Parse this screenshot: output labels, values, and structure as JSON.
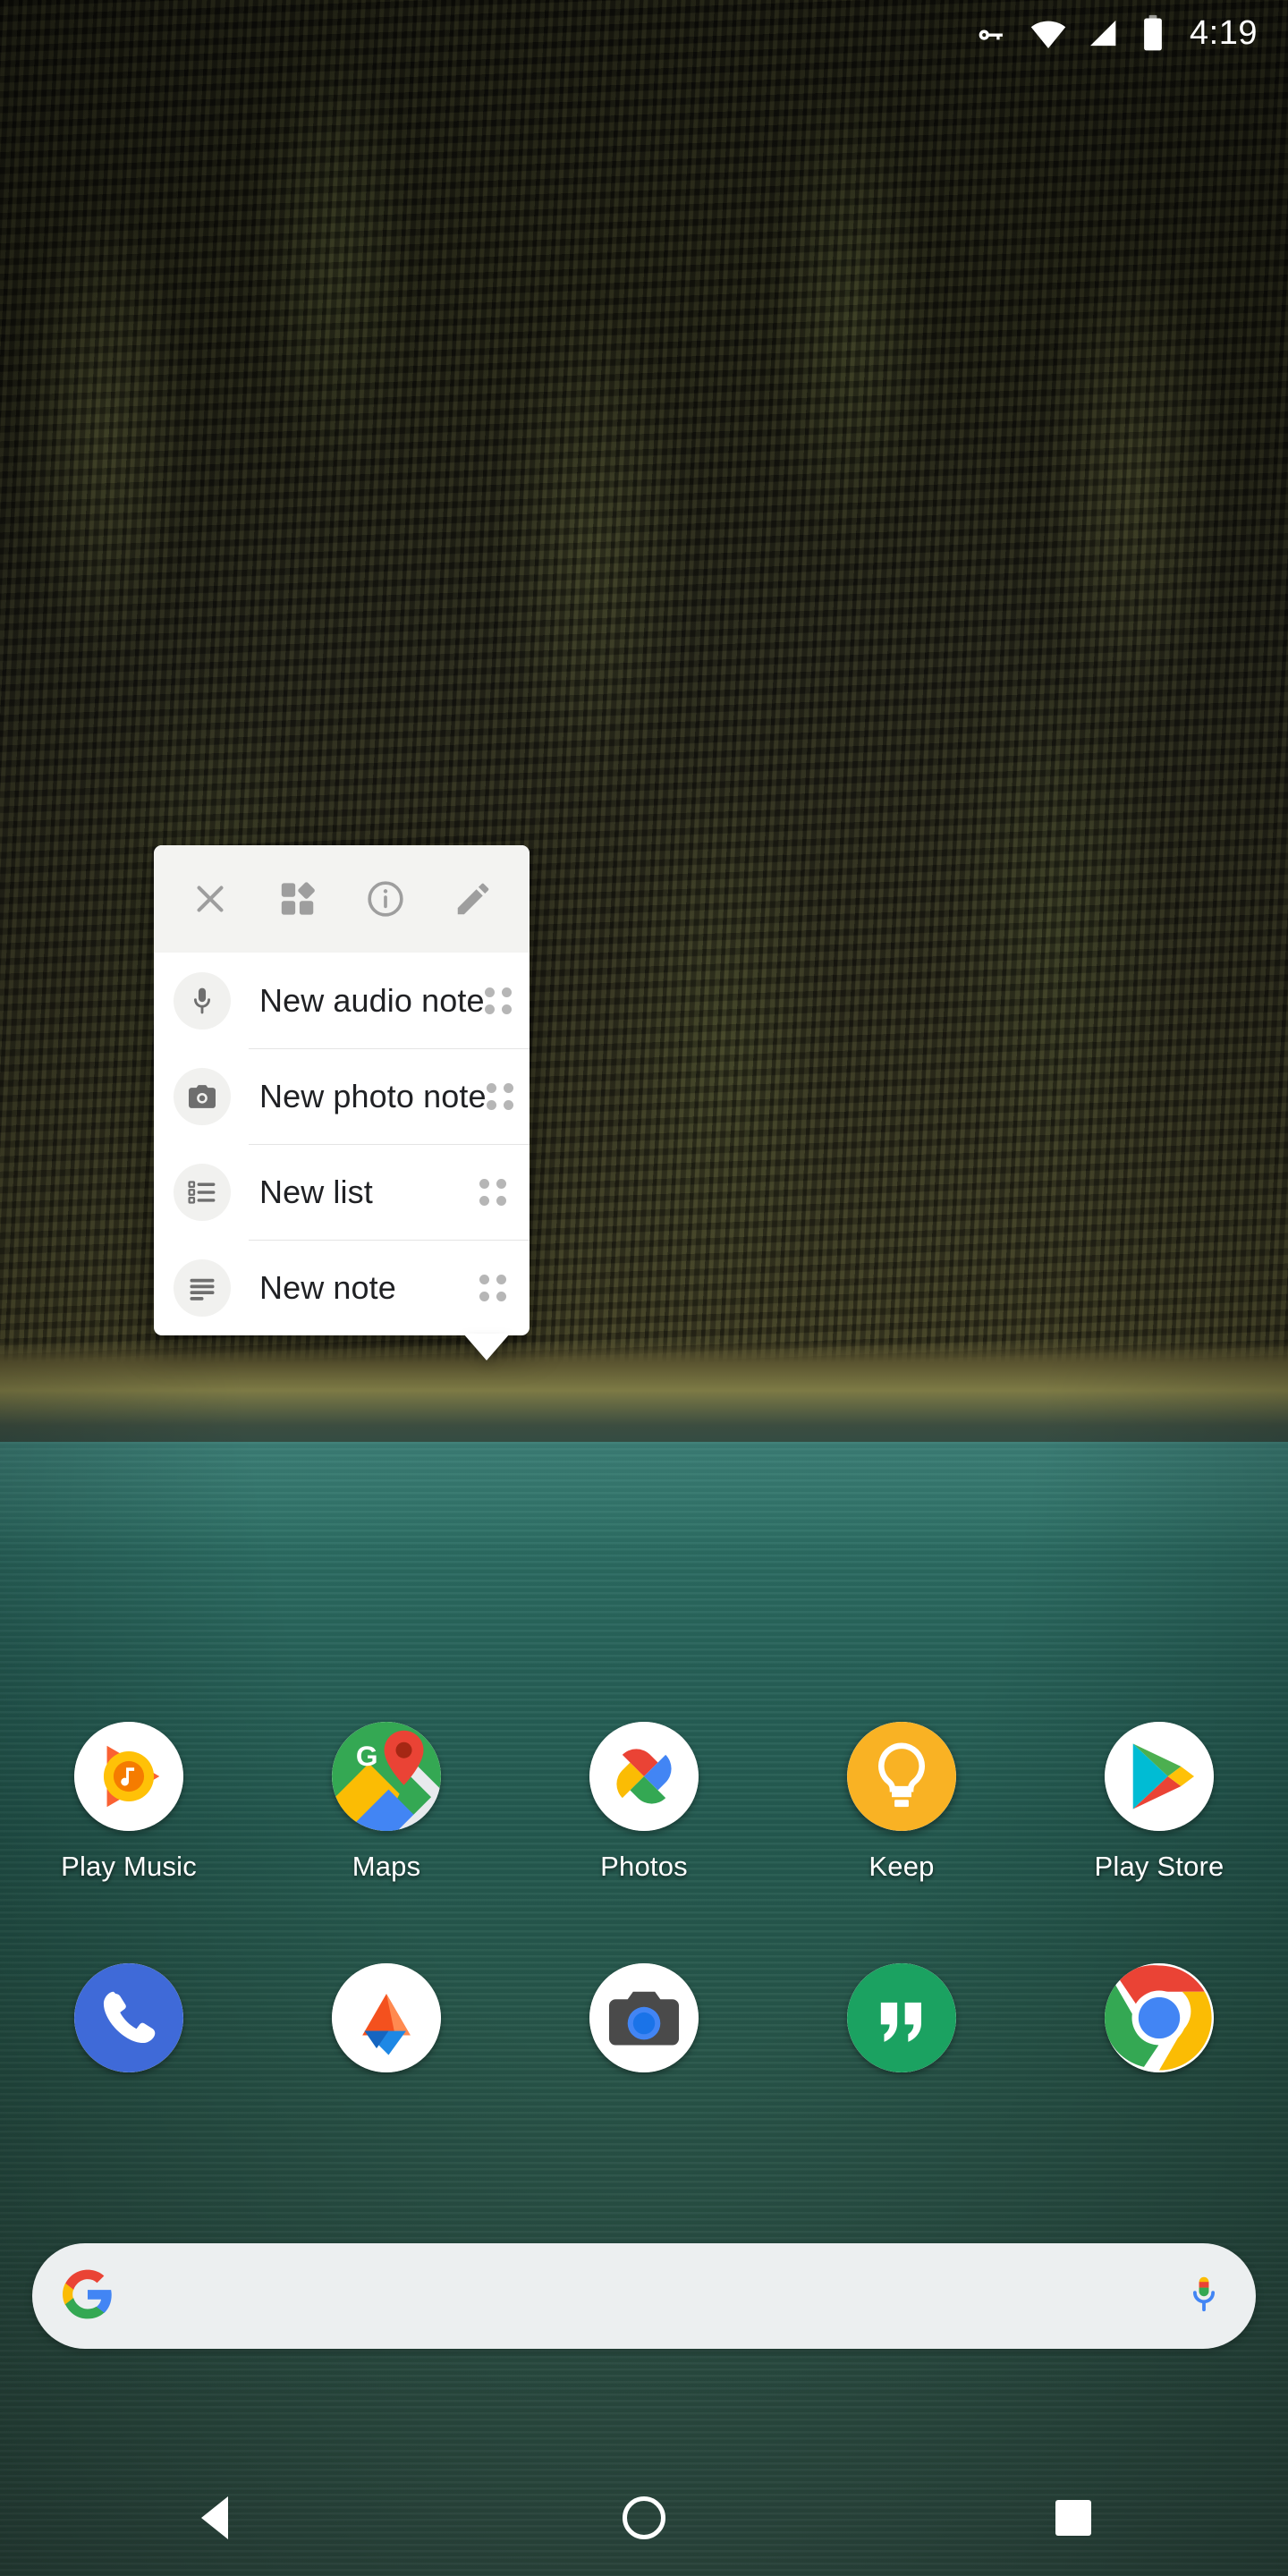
{
  "status_bar": {
    "time": "4:19",
    "icons": [
      "vpn-key-icon",
      "wifi-icon",
      "cellular-signal-icon",
      "battery-icon"
    ]
  },
  "popup": {
    "app": "Keep",
    "header_actions": [
      {
        "name": "close-button",
        "icon": "close-icon",
        "label": "Close"
      },
      {
        "name": "widgets-button",
        "icon": "widgets-icon",
        "label": "Widgets"
      },
      {
        "name": "app-info-button",
        "icon": "info-icon",
        "label": "App info"
      },
      {
        "name": "edit-button",
        "icon": "pencil-icon",
        "label": "Edit"
      }
    ],
    "shortcuts": [
      {
        "label": "New audio note",
        "icon": "microphone-icon"
      },
      {
        "label": "New photo note",
        "icon": "camera-icon"
      },
      {
        "label": "New list",
        "icon": "checklist-icon"
      },
      {
        "label": "New note",
        "icon": "text-lines-icon"
      }
    ]
  },
  "home_screen": {
    "row1": [
      {
        "label": "Play Music",
        "icon": "play-music-icon"
      },
      {
        "label": "Maps",
        "icon": "google-maps-icon"
      },
      {
        "label": "Photos",
        "icon": "google-photos-icon"
      },
      {
        "label": "Keep",
        "icon": "google-keep-icon"
      },
      {
        "label": "Play Store",
        "icon": "google-play-store-icon"
      }
    ],
    "dock": [
      {
        "label": "Phone",
        "icon": "phone-icon"
      },
      {
        "label": "Datally",
        "icon": "datally-icon"
      },
      {
        "label": "Camera",
        "icon": "camera-app-icon"
      },
      {
        "label": "Hangouts",
        "icon": "hangouts-icon"
      },
      {
        "label": "Chrome",
        "icon": "chrome-icon"
      }
    ]
  },
  "search": {
    "value": "",
    "placeholder": "",
    "logo": "google-g-icon",
    "mic": "google-mic-icon"
  },
  "nav_bar": {
    "back": "back-icon",
    "home": "home-icon",
    "recents": "recents-icon"
  },
  "colors": {
    "keep_accent": "#F9B224",
    "popup_bg": "#FFFFFF",
    "popup_header_bg": "#F3F3F1",
    "search_bg": "#ECEFF0"
  }
}
